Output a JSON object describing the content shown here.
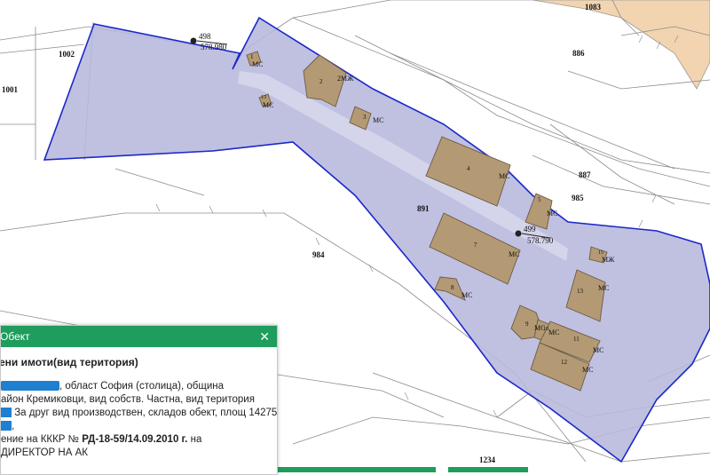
{
  "map": {
    "parcel_numbers": {
      "p1083": "1083",
      "p886": "886",
      "p1002": "1002",
      "p1001": "1001",
      "p887": "887",
      "p985": "985",
      "p891": "891",
      "p984": "984",
      "p1234": "1234"
    },
    "survey_points": [
      {
        "id": "498",
        "value": "578.980"
      },
      {
        "id": "499",
        "value": "578.790"
      }
    ],
    "buildings": [
      {
        "number": "1",
        "use": "МС"
      },
      {
        "number": "2",
        "use": "2МЖ"
      },
      {
        "number": "3",
        "use": "МС"
      },
      {
        "number": "13",
        "use": "МС"
      },
      {
        "number": "4",
        "use": "МС"
      },
      {
        "number": "5",
        "use": "МС"
      },
      {
        "number": "7",
        "use": "МС"
      },
      {
        "number": "8",
        "use": "МС"
      },
      {
        "number": "15",
        "use": "МЖ"
      },
      {
        "number": "13",
        "use": "МС"
      },
      {
        "number": "9",
        "use": "МС"
      },
      {
        "number": "10",
        "use": "МС"
      },
      {
        "number": "11",
        "use": "МС"
      },
      {
        "number": "12",
        "use": "МС"
      }
    ],
    "colors": {
      "parcel_fill": "#b7b7dd",
      "parcel_outline": "#1a28c8",
      "building_fill": "#b39a74",
      "neighbor_fill": "#f2d4b0",
      "road_strip": "#d6d6ec",
      "popup_accent": "#1e9d5c",
      "redaction": "#1f7fd0"
    }
  },
  "popup": {
    "title": "Обект",
    "close_icon": "close-icon",
    "subtitle": "ени имоти(вид територия)",
    "line1": ", област София (столица), община",
    "line2": "айон Кремиковци, вид собств. Частна, вид територия",
    "line3": "За друг вид производствен, складов обект, площ 14275",
    "line4": ",",
    "line5_prefix": "ение на КККР №",
    "line5_order": "РД-18-59/14.09.2010 г.",
    "line5_suffix": "на",
    "line6": "ДИРЕКТОР НА АК"
  }
}
